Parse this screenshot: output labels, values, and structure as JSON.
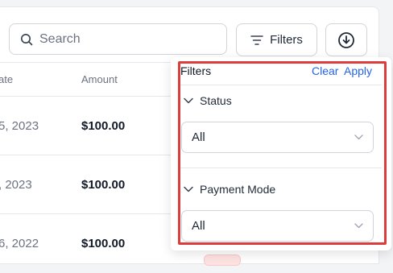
{
  "search": {
    "placeholder": "Search"
  },
  "toolbar": {
    "filters_label": "Filters"
  },
  "table": {
    "headers": [
      "ate",
      "Amount"
    ],
    "rows": [
      {
        "date": "5, 2023",
        "amount": "$100.00"
      },
      {
        "date": ", 2023",
        "amount": "$100.00"
      },
      {
        "date": "6, 2022",
        "amount": "$100.00"
      }
    ]
  },
  "filters_panel": {
    "title": "Filters",
    "clear_label": "Clear",
    "apply_label": "Apply",
    "sections": [
      {
        "label": "Status",
        "value": "All"
      },
      {
        "label": "Payment Mode",
        "value": "All"
      }
    ]
  },
  "colors": {
    "accent": "#2563eb",
    "highlight": "#dc3c3c"
  }
}
